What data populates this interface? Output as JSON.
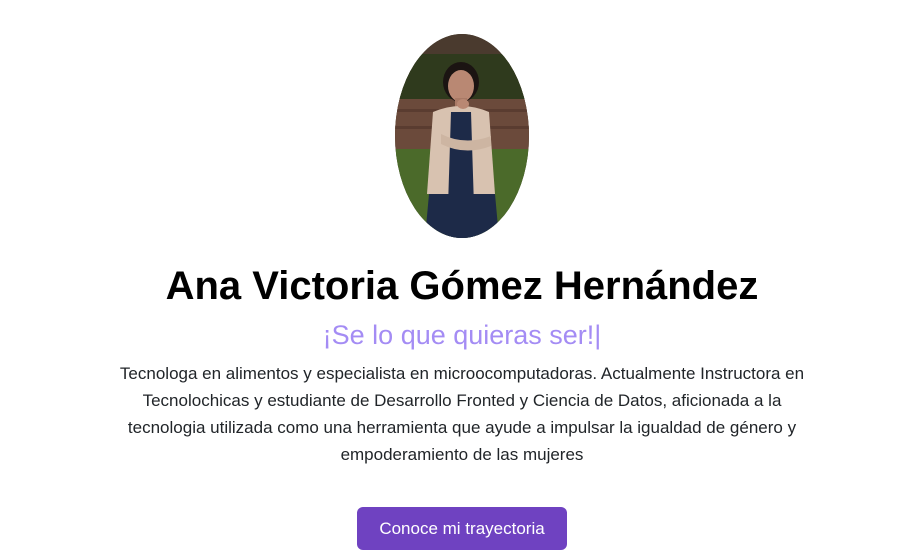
{
  "profile": {
    "name": "Ana Victoria Gómez Hernández",
    "tagline": "¡Se lo que quieras ser!|",
    "bio": "Tecnologa en alimentos y especialista en microocomputadoras. Actualmente Instructora en Tecnolochicas y estudiante de Desarrollo Fronted y Ciencia de Datos, aficionada a la tecnologia utilizada como una herramienta que ayude a impulsar la igualdad de género y empoderamiento de las mujeres",
    "cta_label": "Conoce mi trayectoria"
  },
  "colors": {
    "accent": "#6f42c1",
    "tagline": "#a48cf4",
    "text": "#212529"
  }
}
